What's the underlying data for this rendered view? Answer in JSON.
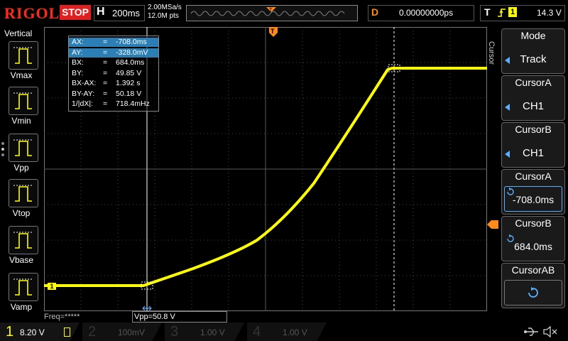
{
  "header": {
    "brand": "RIGOL",
    "run_state": "STOP",
    "timebase_letter": "H",
    "timebase": "200ms",
    "sample_rate": "2.00MSa/s",
    "memory_depth": "12.0M pts",
    "delay_letter": "D",
    "delay": "0.00000000ps",
    "trigger_letter": "T",
    "trigger_channel": "1",
    "trigger_level": "14.3 V"
  },
  "left_panel": {
    "title": "Vertical",
    "items": [
      {
        "label": "Vmax"
      },
      {
        "label": "Vmin"
      },
      {
        "label": "Vpp"
      },
      {
        "label": "Vtop"
      },
      {
        "label": "Vbase"
      },
      {
        "label": "Vamp"
      }
    ]
  },
  "cursor_info": {
    "rows": [
      {
        "key": "AX:",
        "eq": "=",
        "value": "-708.0ms",
        "highlight": true
      },
      {
        "key": "AY:",
        "eq": "=",
        "value": "-328.0mV",
        "highlight": true
      },
      {
        "key": "BX:",
        "eq": "=",
        "value": "684.0ms",
        "highlight": false
      },
      {
        "key": "BY:",
        "eq": "=",
        "value": "49.85 V",
        "highlight": false
      },
      {
        "key": "BX-AX:",
        "eq": "=",
        "value": "1.392 s",
        "highlight": false
      },
      {
        "key": "BY-AY:",
        "eq": "=",
        "value": "50.18 V",
        "highlight": false
      },
      {
        "key": "1/|dX|:",
        "eq": "=",
        "value": "718.4mHz",
        "highlight": false
      }
    ]
  },
  "measurements": {
    "freq": "Freq=*****",
    "vpp": "Vpp=50.8 V"
  },
  "right_menu": {
    "side_label": "Cursor",
    "mode_title": "Mode",
    "mode_value": "Track",
    "cursor_a_source_title": "CursorA",
    "cursor_a_source": "CH1",
    "cursor_b_source_title": "CursorB",
    "cursor_b_source": "CH1",
    "cursor_a_pos_title": "CursorA",
    "cursor_a_pos": "-708.0ms",
    "cursor_b_pos_title": "CursorB",
    "cursor_b_pos": "684.0ms",
    "cursor_ab_title": "CursorAB"
  },
  "channels": [
    {
      "num": "1",
      "value": "8.20 V",
      "color": "#ffff00",
      "active": true
    },
    {
      "num": "2",
      "value": "100mV",
      "color": "#33cccc",
      "active": false
    },
    {
      "num": "3",
      "value": "1.00 V",
      "color": "#cc33cc",
      "active": false
    },
    {
      "num": "4",
      "value": "1.00 V",
      "color": "#3366ff",
      "active": false
    }
  ],
  "marker_labels": {
    "ch1_ground": "1",
    "trigger_pos": "T"
  },
  "colors": {
    "trace": "#ffff00",
    "grid": "#5a5a5a",
    "trigger_marker": "#ff8a1a",
    "highlight": "#2b7fb5"
  }
}
